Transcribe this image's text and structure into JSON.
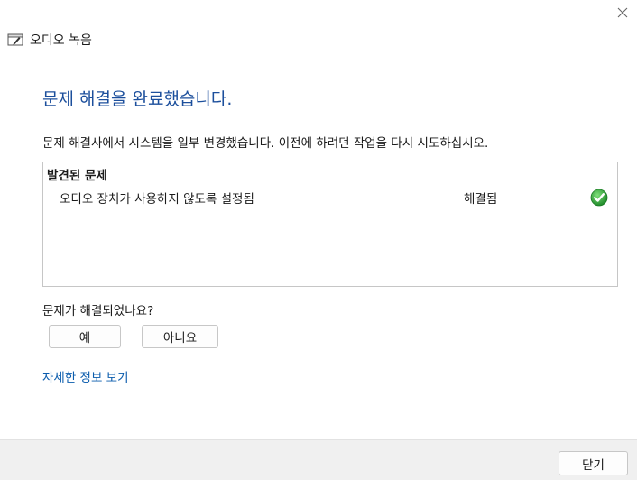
{
  "window": {
    "title": "오디오 녹음",
    "close_icon": "close-icon",
    "app_icon": "troubleshooter-icon"
  },
  "main": {
    "title": "문제 해결을 완료했습니다.",
    "description": "문제 해결사에서 시스템을 일부 변경했습니다. 이전에 하려던 작업을 다시 시도하십시오."
  },
  "problems": {
    "header": "발견된 문제",
    "items": [
      {
        "name": "오디오 장치가 사용하지 않도록 설정됨",
        "status": "해결됨",
        "status_icon": "check-circle-icon",
        "status_color": "#2ea043"
      }
    ]
  },
  "feedback": {
    "question": "문제가 해결되었나요?",
    "yes_label": "예",
    "no_label": "아니요"
  },
  "links": {
    "more_info": "자세한 정보 보기"
  },
  "footer": {
    "close_label": "닫기"
  },
  "colors": {
    "title": "#1c4f9c",
    "link": "#0b5cad",
    "footer_bg": "#f0f0f0"
  }
}
